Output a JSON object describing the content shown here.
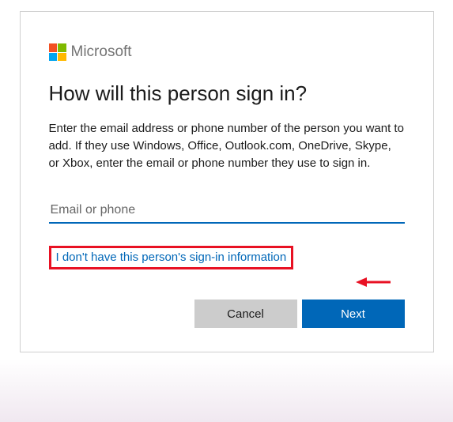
{
  "brand": {
    "name": "Microsoft"
  },
  "heading": "How will this person sign in?",
  "description": "Enter the email address or phone number of the person you want to add. If they use Windows, Office, Outlook.com, OneDrive, Skype, or Xbox, enter the email or phone number they use to sign in.",
  "input": {
    "placeholder": "Email or phone",
    "value": ""
  },
  "link": {
    "no_info": "I don't have this person's sign-in information"
  },
  "buttons": {
    "cancel": "Cancel",
    "next": "Next"
  },
  "annotation": {
    "highlight_color": "#e81123",
    "accent_color": "#0067b8"
  }
}
